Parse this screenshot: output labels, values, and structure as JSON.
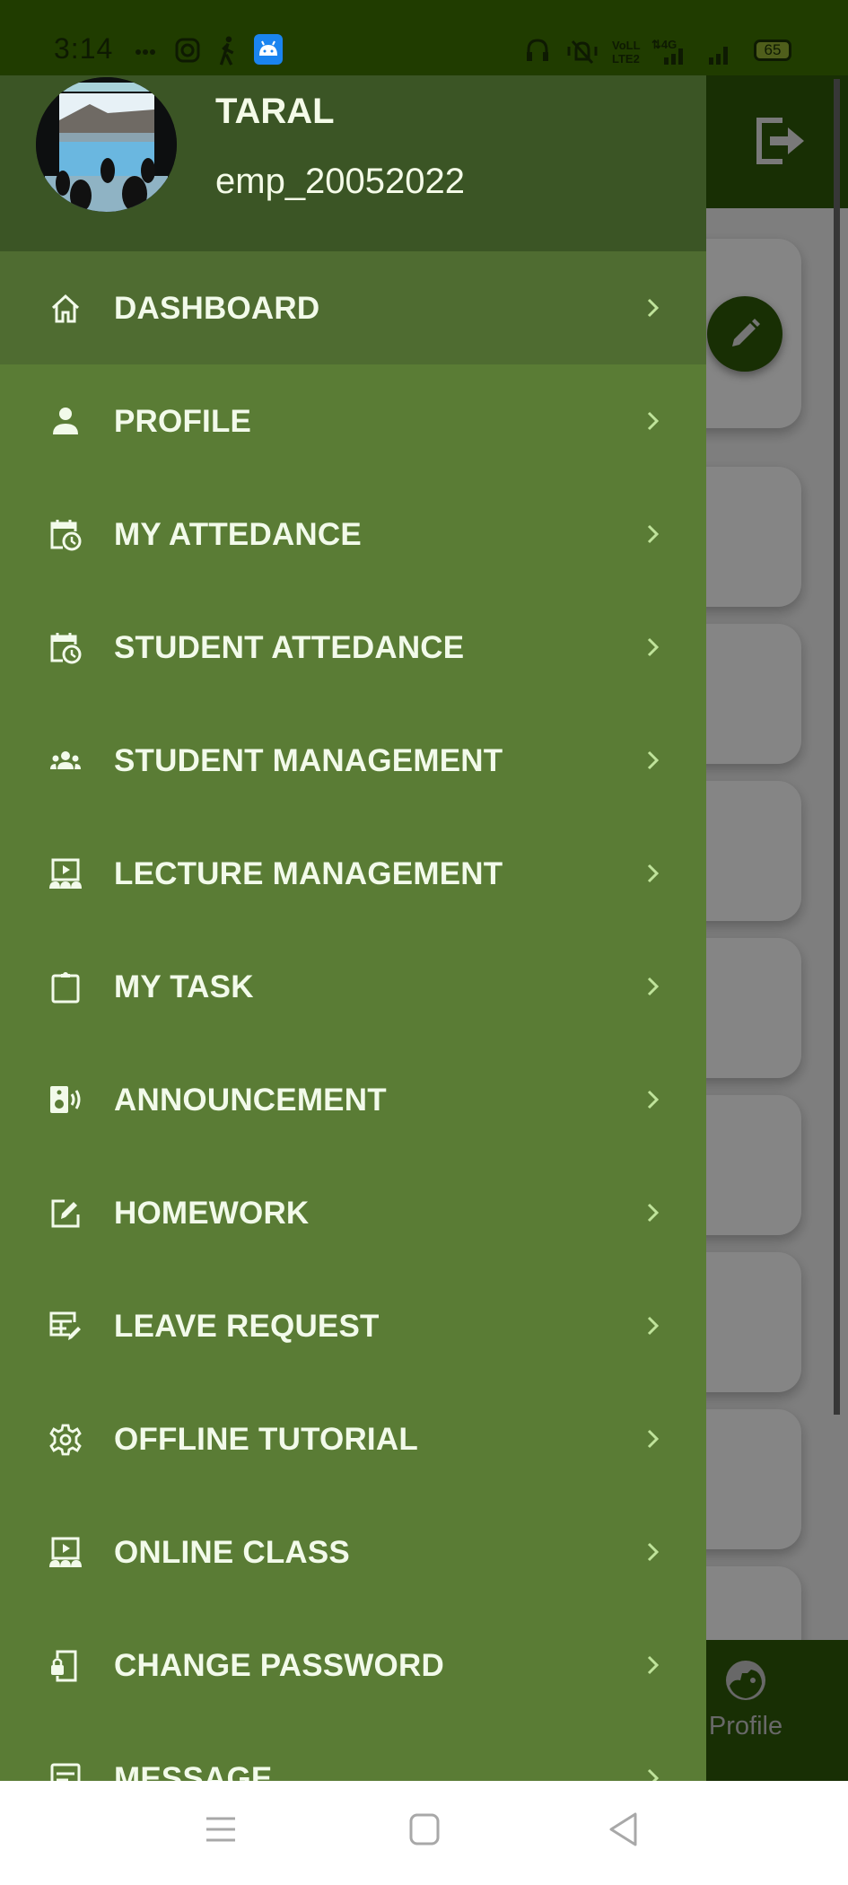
{
  "status_bar": {
    "time": "3:14",
    "left_icons": [
      "more-dots-icon",
      "instagram-icon",
      "walking-icon",
      "android-app-icon"
    ],
    "right_icons": [
      "headphones-icon",
      "vibrate-silent-icon",
      "volte-icon",
      "4g-signal-icon",
      "signal-icon"
    ],
    "battery": "65"
  },
  "drawer": {
    "user": {
      "name": "TARAL",
      "id": "emp_20052022"
    },
    "menu": [
      {
        "label": "DASHBOARD",
        "icon": "home-icon",
        "active": true
      },
      {
        "label": "PROFILE",
        "icon": "person-icon"
      },
      {
        "label": "MY ATTEDANCE",
        "icon": "calendar-clock-icon"
      },
      {
        "label": "STUDENT ATTEDANCE",
        "icon": "calendar-clock-icon"
      },
      {
        "label": "STUDENT MANAGEMENT",
        "icon": "group-icon"
      },
      {
        "label": "LECTURE MANAGEMENT",
        "icon": "lecture-screen-icon"
      },
      {
        "label": "MY TASK",
        "icon": "clipboard-icon"
      },
      {
        "label": "ANNOUNCEMENT",
        "icon": "speaker-icon"
      },
      {
        "label": "HOMEWORK",
        "icon": "edit-square-icon"
      },
      {
        "label": "LEAVE REQUEST",
        "icon": "table-edit-icon"
      },
      {
        "label": "OFFLINE TUTORIAL",
        "icon": "gear-icon"
      },
      {
        "label": "ONLINE CLASS",
        "icon": "lecture-screen-icon"
      },
      {
        "label": "CHANGE PASSWORD",
        "icon": "phone-lock-icon"
      },
      {
        "label": "MESSAGE",
        "icon": "message-icon"
      }
    ]
  },
  "background_app": {
    "bottom_nav_label": "Profile"
  },
  "colors": {
    "status_bar": "#203c00",
    "drawer": "#5a7c35",
    "drawer_header": "#3b5525",
    "active_item": "#4f6c31",
    "app_primary": "#2e5a08",
    "chevron": "#bfe39a"
  }
}
